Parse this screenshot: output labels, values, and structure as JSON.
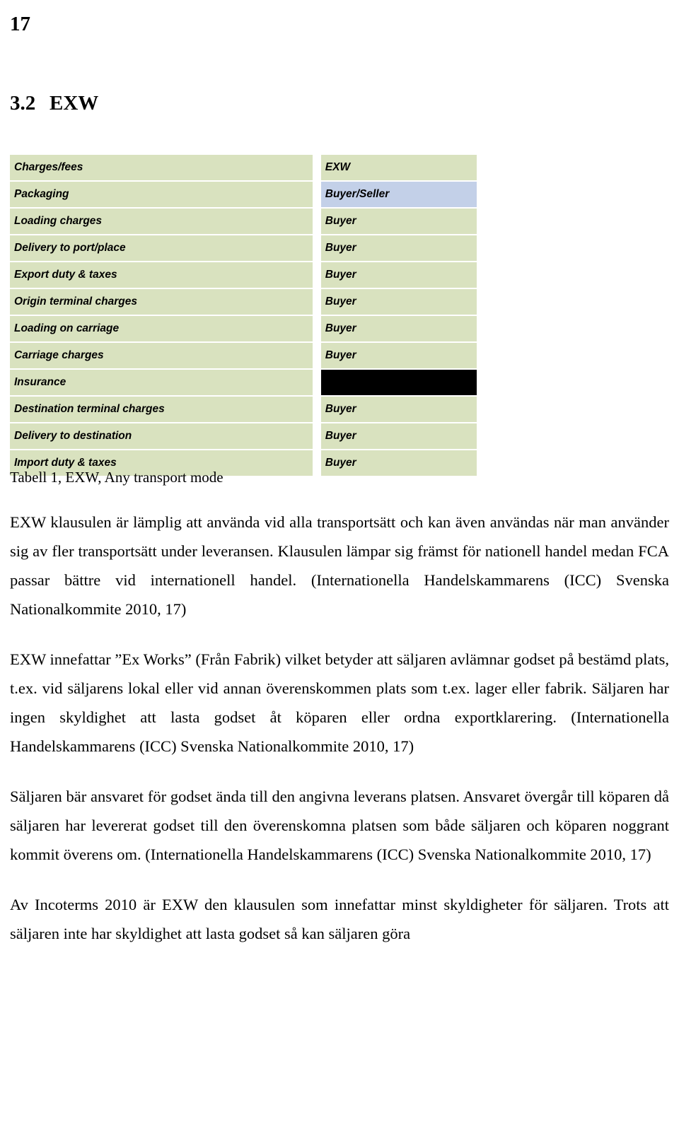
{
  "page": {
    "number": "17",
    "heading_number": "3.2",
    "heading_title": "EXW"
  },
  "table": {
    "rows": [
      {
        "label": "Charges/fees",
        "value": "EXW",
        "value_style": "header"
      },
      {
        "label": "Packaging",
        "value": "Buyer/Seller",
        "value_style": "blue"
      },
      {
        "label": "Loading charges",
        "value": "Buyer",
        "value_style": "normal"
      },
      {
        "label": "Delivery to port/place",
        "value": "Buyer",
        "value_style": "normal"
      },
      {
        "label": "Export duty & taxes",
        "value": "Buyer",
        "value_style": "normal"
      },
      {
        "label": "Origin terminal charges",
        "value": "Buyer",
        "value_style": "normal"
      },
      {
        "label": "Loading on carriage",
        "value": "Buyer",
        "value_style": "normal"
      },
      {
        "label": "Carriage charges",
        "value": "Buyer",
        "value_style": "normal"
      },
      {
        "label": "Insurance",
        "value": "",
        "value_style": "black"
      },
      {
        "label": "Destination terminal charges",
        "value": "Buyer",
        "value_style": "normal"
      },
      {
        "label": "Delivery to destination",
        "value": "Buyer",
        "value_style": "normal"
      },
      {
        "label": "Import duty & taxes",
        "value": "Buyer",
        "value_style": "normal"
      }
    ]
  },
  "caption": "Tabell 1, EXW, Any transport mode",
  "paragraphs": [
    "EXW klausulen är lämplig att använda vid alla transportsätt och kan även användas när man använder sig av fler transportsätt under leveransen. Klausulen lämpar sig främst för nationell handel medan FCA passar bättre vid internationell handel. (Internationella Handelskammarens (ICC) Svenska Nationalkommite 2010, 17)",
    "EXW innefattar ”Ex Works” (Från Fabrik) vilket betyder att säljaren avlämnar godset på bestämd plats, t.ex. vid säljarens lokal eller vid annan överenskommen plats som t.ex. lager eller fabrik. Säljaren har ingen skyldighet att lasta godset åt köparen eller ordna exportklarering. (Internationella Handelskammarens (ICC) Svenska Nationalkommite 2010, 17)",
    "Säljaren bär ansvaret för godset ända till den angivna leverans platsen. Ansvaret övergår till köparen då säljaren har levererat godset till den överenskomna platsen som både säljaren och köparen noggrant kommit överens om. (Internationella Handelskammarens (ICC) Svenska Nationalkommite 2010, 17)",
    "Av Incoterms 2010 är EXW den klausulen som innefattar minst skyldigheter för säljaren. Trots att säljaren inte har skyldighet att lasta godset så kan säljaren göra"
  ]
}
